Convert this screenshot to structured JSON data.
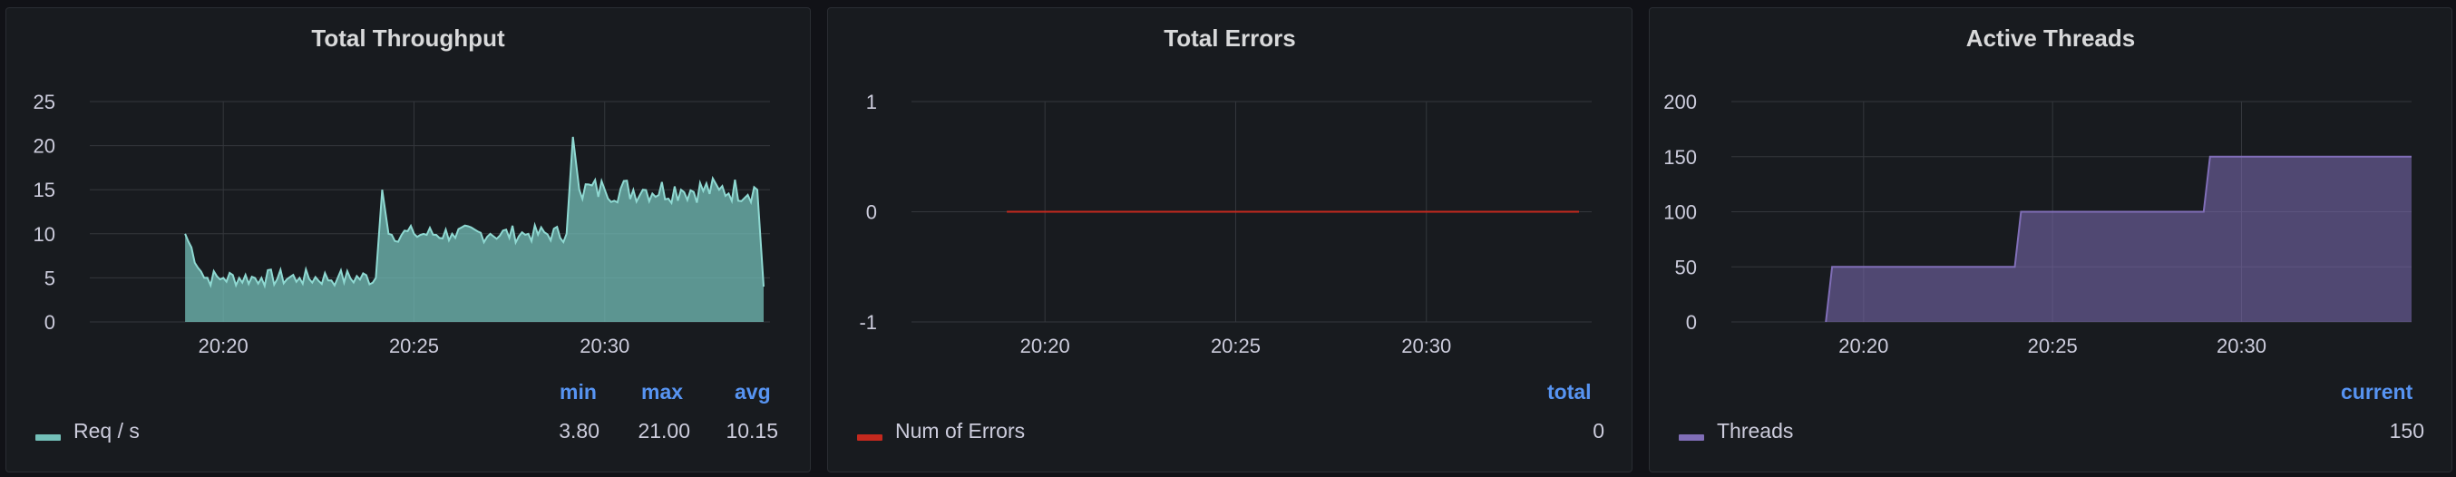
{
  "chart_data": [
    {
      "type": "area",
      "title": "Total Throughput",
      "xlabel": "",
      "ylabel": "",
      "x_ticks": [
        "20:20",
        "20:25",
        "20:30"
      ],
      "y_ticks": [
        0,
        5,
        10,
        15,
        20,
        25
      ],
      "ylim": [
        0,
        25
      ],
      "grid": true,
      "color": "#73bfb8",
      "series": [
        {
          "name": "Req / s",
          "x": [
            "20:19",
            "20:19:30",
            "20:20",
            "20:21",
            "20:22",
            "20:23",
            "20:24",
            "20:24:10",
            "20:24:20",
            "20:25",
            "20:26",
            "20:27",
            "20:28",
            "20:29",
            "20:29:10",
            "20:29:20",
            "20:30",
            "20:31",
            "20:32",
            "20:33",
            "20:34",
            "20:34:10"
          ],
          "values": [
            10,
            5,
            5,
            5,
            5,
            5,
            5,
            15,
            10,
            10,
            10,
            10,
            10,
            10,
            21,
            15,
            15,
            15,
            15,
            15,
            15,
            4
          ]
        }
      ],
      "legend": {
        "placement": "bottom",
        "headers": [
          "min",
          "max",
          "avg"
        ],
        "rows": [
          {
            "name": "Req / s",
            "values": [
              "3.80",
              "21.00",
              "10.15"
            ]
          }
        ]
      }
    },
    {
      "type": "line",
      "title": "Total Errors",
      "xlabel": "",
      "ylabel": "",
      "x_ticks": [
        "20:20",
        "20:25",
        "20:30"
      ],
      "y_ticks": [
        -1,
        0,
        1
      ],
      "ylim": [
        -1,
        1
      ],
      "grid": true,
      "color": "#c4291e",
      "series": [
        {
          "name": "Num of Errors",
          "x": [
            "20:19",
            "20:34"
          ],
          "values": [
            0,
            0
          ]
        }
      ],
      "legend": {
        "placement": "bottom",
        "headers": [
          "total"
        ],
        "rows": [
          {
            "name": "Num of Errors",
            "values": [
              "0"
            ]
          }
        ]
      }
    },
    {
      "type": "area",
      "title": "Active Threads",
      "xlabel": "",
      "ylabel": "",
      "x_ticks": [
        "20:20",
        "20:25",
        "20:30"
      ],
      "y_ticks": [
        0,
        50,
        100,
        150,
        200
      ],
      "ylim": [
        0,
        200
      ],
      "grid": true,
      "color": "#806eb7",
      "series": [
        {
          "name": "Threads",
          "x": [
            "20:19",
            "20:19:10",
            "20:24",
            "20:24:10",
            "20:29",
            "20:29:10",
            "20:34:30"
          ],
          "values": [
            0,
            50,
            50,
            100,
            100,
            150,
            150
          ]
        }
      ],
      "legend": {
        "placement": "bottom",
        "headers": [
          "current"
        ],
        "rows": [
          {
            "name": "Threads",
            "values": [
              "150"
            ]
          }
        ]
      }
    }
  ]
}
